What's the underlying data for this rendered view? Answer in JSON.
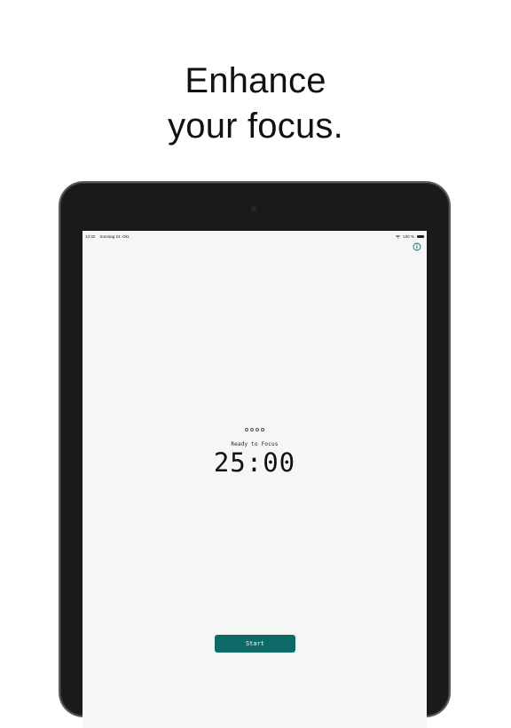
{
  "headline": {
    "line1": "Enhance",
    "line2": "your focus."
  },
  "status_bar": {
    "time": "13:32",
    "date": "Sonntag 24. Okt.",
    "battery_text": "100 %"
  },
  "icons": {
    "info": "info-circle-icon",
    "wifi": "wifi-icon",
    "battery": "battery-icon"
  },
  "session": {
    "completed": 0,
    "total": 4
  },
  "timer": {
    "status": "Ready to Focus",
    "value": "25:00"
  },
  "controls": {
    "start_label": "Start"
  },
  "colors": {
    "accent": "#0d6a66",
    "screen_bg": "#f4f7f6",
    "device_frame": "#1a1a1a"
  }
}
